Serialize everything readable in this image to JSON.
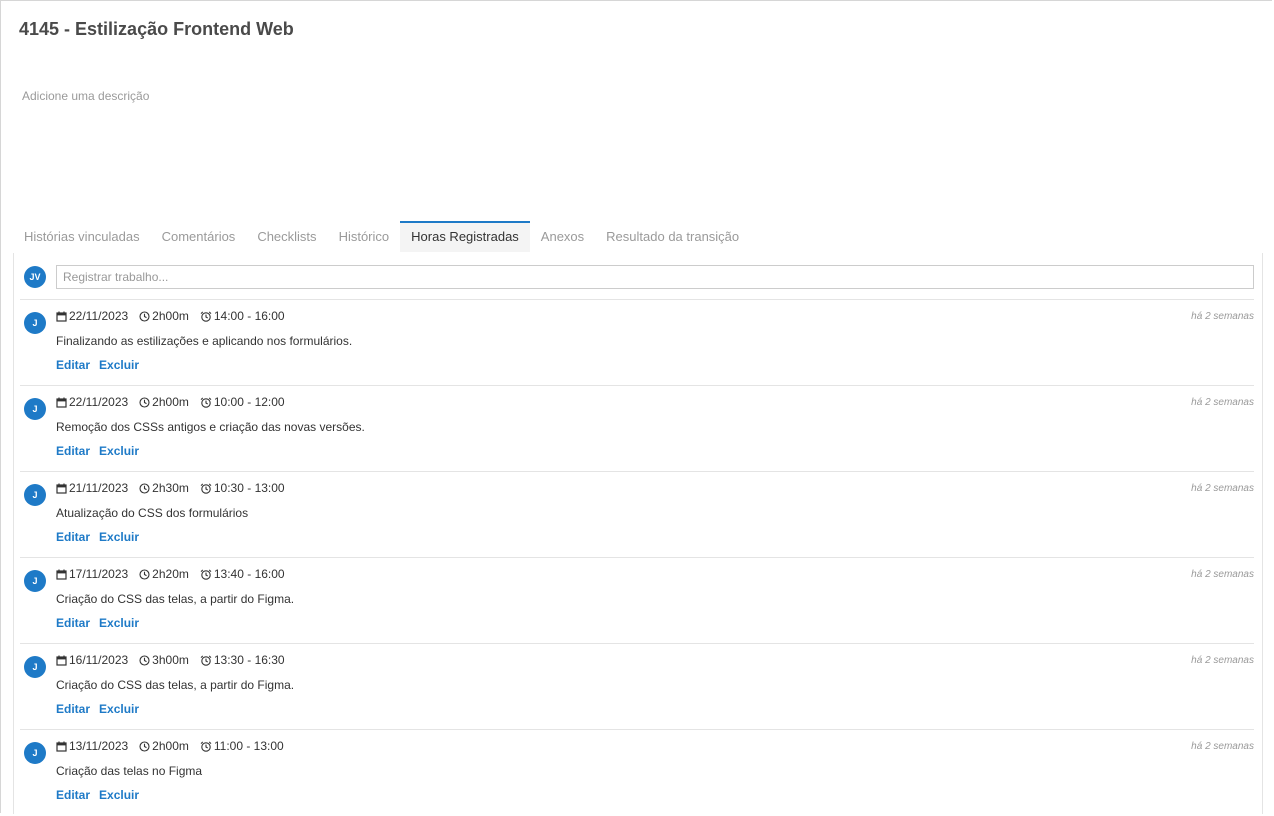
{
  "task": {
    "title": "4145 - Estilização Frontend Web",
    "description_placeholder": "Adicione uma descrição"
  },
  "accent_color": "#1e7ac7",
  "tabs": [
    {
      "label": "Histórias vinculadas",
      "active": false
    },
    {
      "label": "Comentários",
      "active": false
    },
    {
      "label": "Checklists",
      "active": false
    },
    {
      "label": "Histórico",
      "active": false
    },
    {
      "label": "Horas Registradas",
      "active": true
    },
    {
      "label": "Anexos",
      "active": false
    },
    {
      "label": "Resultado da transição",
      "active": false
    }
  ],
  "register": {
    "avatar": "JV",
    "placeholder": "Registrar trabalho..."
  },
  "entries": [
    {
      "avatar": "J",
      "date": "22/11/2023",
      "duration": "2h00m",
      "time_range": "14:00 - 16:00",
      "ago": "há 2 semanas",
      "note": "Finalizando as estilizações e aplicando nos formulários.",
      "edit": "Editar",
      "delete": "Excluir"
    },
    {
      "avatar": "J",
      "date": "22/11/2023",
      "duration": "2h00m",
      "time_range": "10:00 - 12:00",
      "ago": "há 2 semanas",
      "note": "Remoção dos CSSs antigos e criação das novas versões.",
      "edit": "Editar",
      "delete": "Excluir"
    },
    {
      "avatar": "J",
      "date": "21/11/2023",
      "duration": "2h30m",
      "time_range": "10:30 - 13:00",
      "ago": "há 2 semanas",
      "note": "Atualização do CSS dos formulários",
      "edit": "Editar",
      "delete": "Excluir"
    },
    {
      "avatar": "J",
      "date": "17/11/2023",
      "duration": "2h20m",
      "time_range": "13:40 - 16:00",
      "ago": "há 2 semanas",
      "note": "Criação do CSS das telas, a partir do Figma.",
      "edit": "Editar",
      "delete": "Excluir"
    },
    {
      "avatar": "J",
      "date": "16/11/2023",
      "duration": "3h00m",
      "time_range": "13:30 - 16:30",
      "ago": "há 2 semanas",
      "note": "Criação do CSS das telas, a partir do Figma.",
      "edit": "Editar",
      "delete": "Excluir"
    },
    {
      "avatar": "J",
      "date": "13/11/2023",
      "duration": "2h00m",
      "time_range": "11:00 - 13:00",
      "ago": "há 2 semanas",
      "note": "Criação das telas no Figma",
      "edit": "Editar",
      "delete": "Excluir"
    }
  ],
  "icons": {
    "date": "calendar-icon",
    "duration": "clock-icon",
    "time_range": "alarm-clock-icon"
  }
}
